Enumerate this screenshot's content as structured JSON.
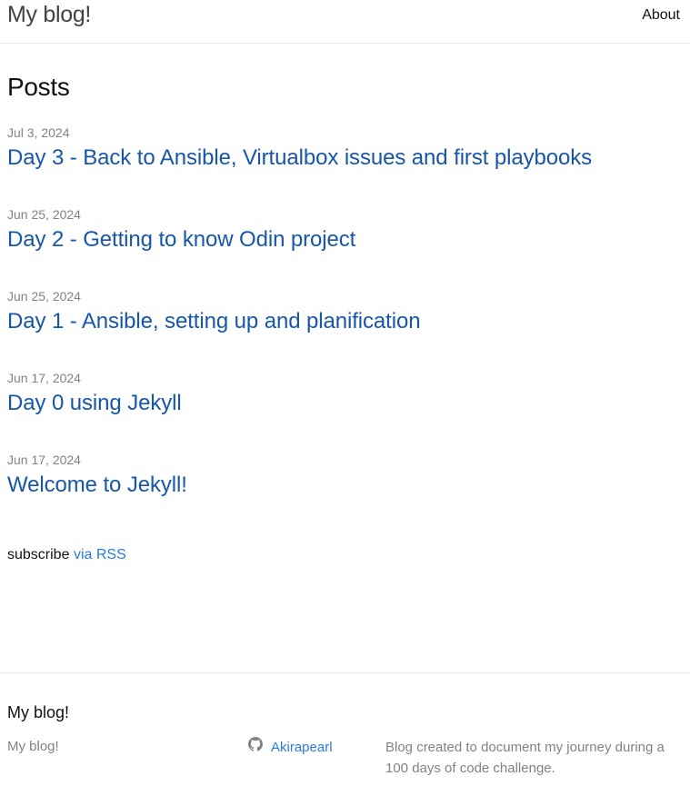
{
  "header": {
    "site_title": "My blog!",
    "nav": {
      "about": "About"
    }
  },
  "main": {
    "heading": "Posts",
    "posts": [
      {
        "date": "Jul 3, 2024",
        "title": "Day 3 - Back to Ansible, Virtualbox issues and first playbooks"
      },
      {
        "date": "Jun 25, 2024",
        "title": "Day 2 - Getting to know Odin project"
      },
      {
        "date": "Jun 25, 2024",
        "title": "Day 1 - Ansible, setting up and planification"
      },
      {
        "date": "Jun 17, 2024",
        "title": "Day 0 using Jekyll"
      },
      {
        "date": "Jun 17, 2024",
        "title": "Welcome to Jekyll!"
      }
    ],
    "rss": {
      "prefix": "subscribe",
      "link": "via RSS"
    }
  },
  "footer": {
    "heading": "My blog!",
    "col1_text": "My blog!",
    "github_user": "Akirapearl",
    "description": "Blog created to document my journey during a 100 days of code challenge."
  },
  "colors": {
    "link": "#2a7ae2",
    "link_visited": "#1756a9",
    "muted_text": "#828282",
    "border": "#e8e8e8"
  },
  "icons": {
    "github": "github-icon"
  }
}
